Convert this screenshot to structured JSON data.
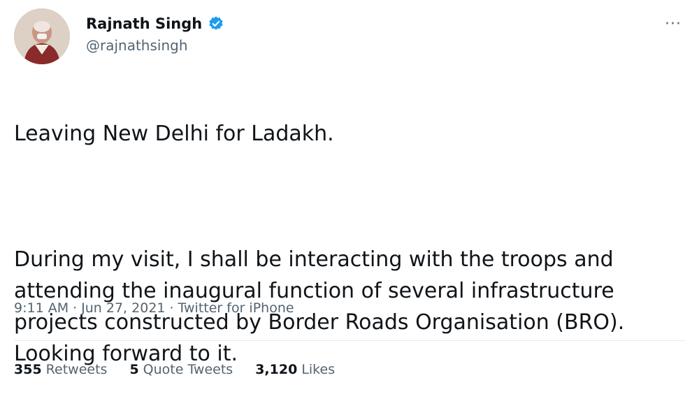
{
  "user": {
    "display_name": "Rajnath Singh",
    "handle": "@rajnathsingh",
    "verified_icon": "verified-badge-icon",
    "verified_color": "#1d9bf0"
  },
  "tweet": {
    "paragraph_1": "Leaving New Delhi for Ladakh.",
    "paragraph_2": "During my visit, I shall be interacting with the troops and attending the inaugural function of several infrastructure projects constructed by Border Roads Organisation (BRO). Looking forward to it."
  },
  "meta": {
    "time": "9:11 AM",
    "date": "Jun 27, 2021",
    "source": "Twitter for iPhone",
    "separator": "·"
  },
  "stats": {
    "retweets_count": "355",
    "retweets_label": "Retweets",
    "quote_count": "5",
    "quote_label": "Quote Tweets",
    "likes_count": "3,120",
    "likes_label": "Likes"
  },
  "menu": {
    "more_glyph": "···"
  },
  "colors": {
    "text_primary": "#0f1419",
    "text_secondary": "#536471",
    "divider": "#e6ecf0"
  }
}
